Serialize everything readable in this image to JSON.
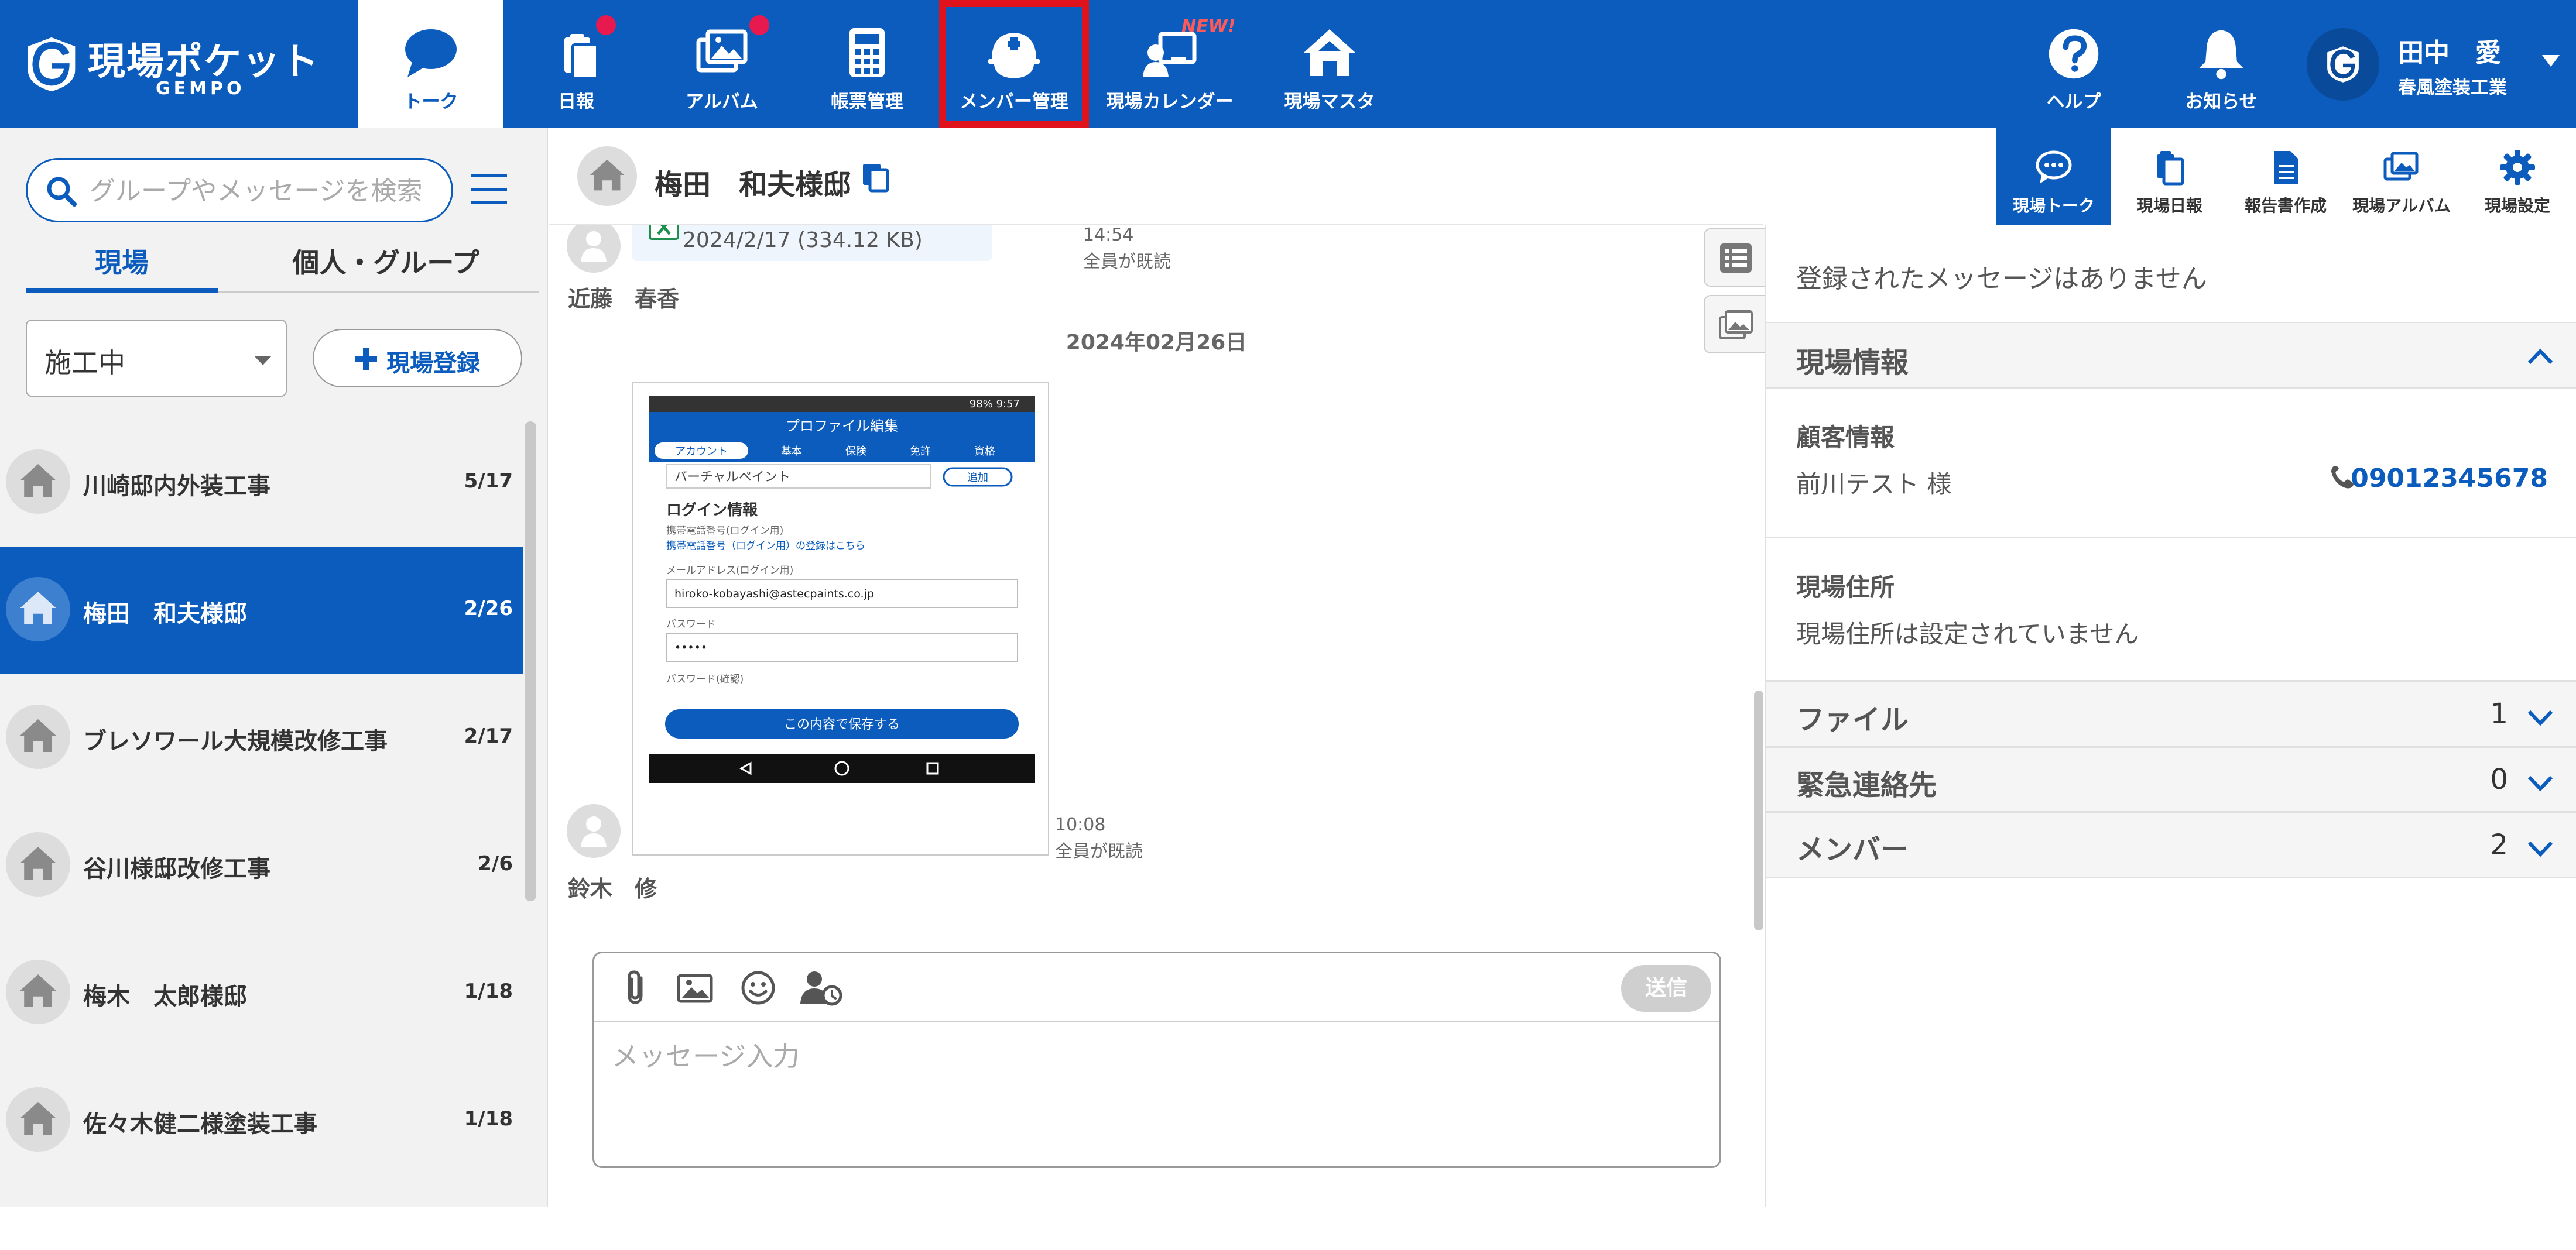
{
  "app": {
    "logo_text": "現場ポケット",
    "logo_sub": "GEMPO"
  },
  "nav": {
    "items": [
      {
        "label": "トーク",
        "icon": "chat-bubble-icon",
        "active": true
      },
      {
        "label": "日報",
        "icon": "daily-report-icon",
        "badge": true
      },
      {
        "label": "アルバム",
        "icon": "album-icon",
        "badge": true
      },
      {
        "label": "帳票管理",
        "icon": "calculator-icon"
      },
      {
        "label": "メンバー管理",
        "icon": "helmet-icon",
        "highlight": true
      },
      {
        "label": "現場カレンダー",
        "icon": "calendar-user-icon",
        "new_badge": "NEW!"
      },
      {
        "label": "現場マスタ",
        "icon": "house-icon"
      }
    ],
    "help_label": "ヘルプ",
    "notify_label": "お知らせ"
  },
  "user": {
    "name": "田中　愛",
    "company": "春風塗装工業"
  },
  "sidebar": {
    "search_placeholder": "グループやメッセージを検索",
    "tabs": [
      "現場",
      "個人・グループ"
    ],
    "status_value": "施工中",
    "add_site_label": "現場登録",
    "sites": [
      {
        "name": "川崎邸内外装工事",
        "count": "5/17"
      },
      {
        "name": "梅田　和夫様邸",
        "count": "2/26",
        "selected": true
      },
      {
        "name": "ブレソワール大規模改修工事",
        "count": "2/17"
      },
      {
        "name": "谷川様邸改修工事",
        "count": "2/6"
      },
      {
        "name": "梅木　太郎様邸",
        "count": "1/18"
      },
      {
        "name": "佐々木健二様塗装工事",
        "count": "1/18"
      }
    ]
  },
  "chat": {
    "title": "梅田　和夫様邸",
    "file_date": "2024/2/17 (334.12 KB)",
    "msg1_time": "14:54",
    "msg1_read": "全員が既読",
    "msg1_sender": "近藤　春香",
    "date_separator": "2024年02月26日",
    "msg2_time": "10:08",
    "msg2_read": "全員が既読",
    "msg2_sender": "鈴木　修",
    "input_placeholder": "メッセージ入力",
    "send_label": "送信"
  },
  "screenshot": {
    "header": "プロファイル編集",
    "tabs": [
      "アカウント",
      "基本",
      "保険",
      "免許",
      "資格"
    ],
    "paint_value": "バーチャルペイント",
    "add_label": "追加",
    "login_title": "ログイン情報",
    "phone_label": "携帯電話番号(ログイン用)",
    "phone_link": "携帯電話番号（ログイン用）の登録はこちら",
    "email_label": "メールアドレス(ログイン用)",
    "email_value": "hiroko-kobayashi@astecpaints.co.jp",
    "password_label": "パスワード",
    "password_value": "•••••",
    "password_confirm_label": "パスワード(確認)",
    "save_label": "この内容で保存する",
    "status_bar": "98% 9:57"
  },
  "right_tabs": [
    {
      "label": "現場トーク",
      "active": true
    },
    {
      "label": "現場日報"
    },
    {
      "label": "報告書作成"
    },
    {
      "label": "現場アルバム"
    },
    {
      "label": "現場設定"
    }
  ],
  "right_panel": {
    "no_messages": "登録されたメッセージはありません",
    "site_info_title": "現場情報",
    "customer_label": "顧客情報",
    "customer_name": "前川テスト 様",
    "customer_phone": "09012345678",
    "address_label": "現場住所",
    "address_value": "現場住所は設定されていません",
    "sections": [
      {
        "title": "ファイル",
        "count": "1"
      },
      {
        "title": "緊急連絡先",
        "count": "0"
      },
      {
        "title": "メンバー",
        "count": "2"
      }
    ]
  }
}
